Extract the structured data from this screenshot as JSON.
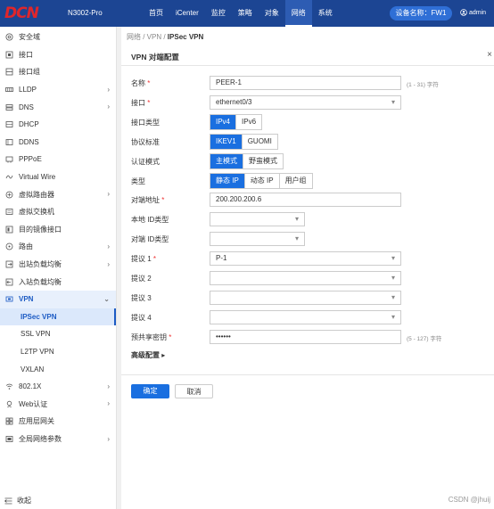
{
  "header": {
    "model": "N3002-Pro",
    "nav": [
      "首页",
      "iCenter",
      "监控",
      "策略",
      "对象",
      "网络",
      "系统"
    ],
    "active_nav": "网络",
    "device_label": "设备名称：FW1",
    "user": "admin",
    "logo_text": "DCN"
  },
  "sidebar": {
    "items": [
      {
        "label": "安全域",
        "icon": "shield-icon"
      },
      {
        "label": "接口",
        "icon": "interface-icon"
      },
      {
        "label": "接口组",
        "icon": "interface-group-icon"
      },
      {
        "label": "LLDP",
        "icon": "lldp-icon"
      },
      {
        "label": "DNS",
        "icon": "dns-icon"
      },
      {
        "label": "DHCP",
        "icon": "dhcp-icon"
      },
      {
        "label": "DDNS",
        "icon": "ddns-icon"
      },
      {
        "label": "PPPoE",
        "icon": "pppoe-icon"
      },
      {
        "label": "Virtual Wire",
        "icon": "virtual-wire-icon"
      },
      {
        "label": "虚拟路由器",
        "icon": "virtual-router-icon"
      },
      {
        "label": "虚拟交换机",
        "icon": "virtual-switch-icon"
      },
      {
        "label": "目的镜像接口",
        "icon": "mirror-icon"
      },
      {
        "label": "路由",
        "icon": "route-icon"
      },
      {
        "label": "出站负载均衡",
        "icon": "outbound-lb-icon"
      },
      {
        "label": "入站负载均衡",
        "icon": "inbound-lb-icon"
      },
      {
        "label": "VPN",
        "icon": "vpn-icon"
      }
    ],
    "vpn_sub": [
      "IPSec VPN",
      "SSL VPN",
      "L2TP VPN",
      "VXLAN"
    ],
    "bottom_items": [
      {
        "label": "802.1X",
        "icon": "wifi-icon"
      },
      {
        "label": "Web认证",
        "icon": "web-auth-icon"
      },
      {
        "label": "应用层网关",
        "icon": "gateway-icon"
      },
      {
        "label": "全局网络参数",
        "icon": "global-params-icon"
      }
    ],
    "collapse_label": "收起"
  },
  "breadcrumb": {
    "prefix": "网络 / VPN / ",
    "current": "IPSec VPN"
  },
  "panel": {
    "title": "VPN 对端配置",
    "close": "×"
  },
  "form": {
    "name_label": "名称",
    "name_value": "PEER-1",
    "name_hint": "(1 - 31) 字符",
    "interface_label": "接口",
    "interface_value": "ethernet0/3",
    "iftype_label": "接口类型",
    "iftype_options": [
      "IPv4",
      "IPv6"
    ],
    "protocol_label": "协议标准",
    "protocol_options": [
      "IKEV1",
      "GUOMI"
    ],
    "auth_label": "认证模式",
    "auth_options": [
      "主模式",
      "野蛮模式"
    ],
    "type_label": "类型",
    "type_options": [
      "静态 IP",
      "动态 IP",
      "用户组"
    ],
    "peer_label": "对端地址",
    "peer_value": "200.200.200.6",
    "local_id_label": "本地 ID类型",
    "peer_id_label": "对端 ID类型",
    "proposal1_label": "提议 1",
    "proposal1_value": "P-1",
    "proposal2_label": "提议 2",
    "proposal3_label": "提议 3",
    "proposal4_label": "提议 4",
    "psk_label": "预共享密钥",
    "psk_value": "••••••",
    "psk_hint": "(5 - 127) 字符",
    "advanced_label": "高级配置 ▸",
    "ok_label": "确定",
    "cancel_label": "取消"
  },
  "watermark": "CSDN @jhuij"
}
